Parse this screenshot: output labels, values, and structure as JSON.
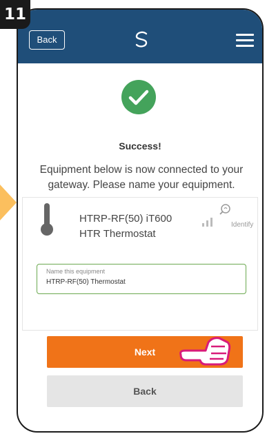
{
  "step": {
    "number": "11"
  },
  "header": {
    "back_label": "Back",
    "logo_icon": "salus-logo-icon",
    "menu_icon": "hamburger-menu-icon",
    "color": "#1f4e79"
  },
  "success": {
    "icon": "checkmark-icon",
    "title": "Success!",
    "message": "Equipment below is now connected to your gateway. Please name your equipment."
  },
  "device": {
    "icon": "thermometer-icon",
    "model": "HTRP-RF(50) iT600",
    "type": "HTR Thermostat",
    "signal_icon": "signal-strength-icon",
    "identify_icon": "identify-icon",
    "identify_label": "Identify"
  },
  "name_field": {
    "label": "Name this equipment",
    "value": "HTRP-RF(50) Thermostat"
  },
  "actions": {
    "next_label": "Next",
    "back_label": "Back",
    "next_color": "#f07318"
  },
  "annotation": {
    "hand_icon": "pointing-hand-icon"
  }
}
